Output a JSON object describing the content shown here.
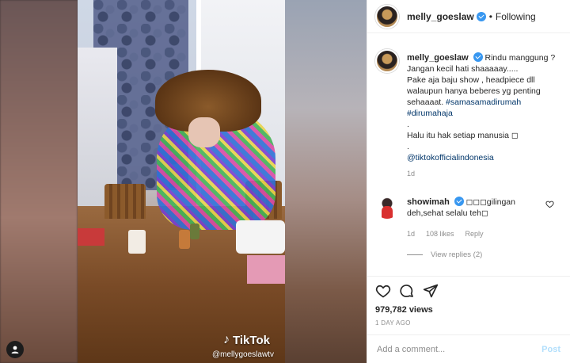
{
  "post": {
    "author": "melly_goeslaw",
    "follow_status": "Following",
    "separator": "•",
    "caption": {
      "lines": [
        "Rindu manggung ?",
        "Jangan kecil hati shaaaaay.....",
        "Pake aja baju show , headpiece dll walaupun hanya beberes yg penting sehaaaat."
      ],
      "hashtag1": "#samasamadirumah",
      "hashtag2": "#dirumahaja",
      "dot1": ".",
      "halu": "Halu itu hak setiap manusia ◻",
      "dot2": ".",
      "mention": "@tiktokofficialindonesia",
      "time": "1d"
    },
    "comment": {
      "username": "showimah",
      "text": "◻◻◻gilingan deh,sehat selalu teh◻",
      "time": "1d",
      "likes": "108 likes",
      "reply": "Reply",
      "view_replies": "View replies (2)"
    },
    "views": "979,782 views",
    "age": "1 DAY AGO",
    "add_comment_placeholder": "Add a comment...",
    "post_button": "Post"
  },
  "video": {
    "watermark": "TikTok",
    "handle": "@mellygoeslawtv"
  },
  "colors": {
    "accent": "#3897f0",
    "link": "#003569",
    "muted": "#8e8e8e",
    "post_disabled": "#b2dffc"
  },
  "icons": [
    "heart-icon",
    "comment-icon",
    "share-icon",
    "verified-icon",
    "user-tag-icon",
    "tiktok-note-icon"
  ]
}
